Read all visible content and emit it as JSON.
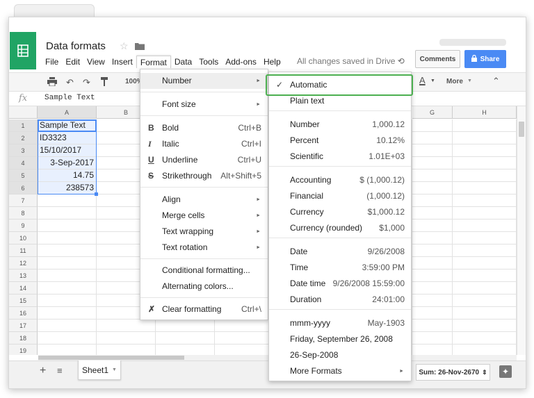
{
  "app": {
    "doc_title": "Data formats",
    "menus": [
      "File",
      "Edit",
      "View",
      "Insert",
      "Format",
      "Data",
      "Tools",
      "Add-ons",
      "Help"
    ],
    "active_menu": "Format",
    "saved_status": "All changes saved in Drive",
    "comments_label": "Comments",
    "share_label": "Share"
  },
  "toolbar": {
    "zoom": "100%",
    "more_label": "More",
    "text_color_glyph": "A"
  },
  "formula_bar": {
    "fx": "fx",
    "value": "Sample Text"
  },
  "grid": {
    "columns": [
      "A",
      "B",
      "G",
      "H"
    ],
    "rows": [
      "1",
      "2",
      "3",
      "4",
      "5",
      "6",
      "7",
      "8",
      "9",
      "10",
      "11",
      "12",
      "13",
      "14",
      "15",
      "16",
      "17",
      "18",
      "19"
    ],
    "cells": [
      {
        "text": "Sample Text",
        "align": "left"
      },
      {
        "text": "ID3323",
        "align": "left"
      },
      {
        "text": "15/10/2017",
        "align": "left"
      },
      {
        "text": "3-Sep-2017",
        "align": "right"
      },
      {
        "text": "14.75",
        "align": "right"
      },
      {
        "text": "238573",
        "align": "right"
      }
    ]
  },
  "format_menu": {
    "number": "Number",
    "font_size": "Font size",
    "bold": "Bold",
    "bold_sc": "Ctrl+B",
    "italic": "Italic",
    "italic_sc": "Ctrl+I",
    "underline": "Underline",
    "underline_sc": "Ctrl+U",
    "strike": "Strikethrough",
    "strike_sc": "Alt+Shift+5",
    "align": "Align",
    "merge": "Merge cells",
    "wrap": "Text wrapping",
    "rotate": "Text rotation",
    "conditional": "Conditional formatting...",
    "alternating": "Alternating colors...",
    "clear": "Clear formatting",
    "clear_sc": "Ctrl+\\"
  },
  "number_menu": {
    "items": [
      {
        "label": "Automatic",
        "value": ""
      },
      {
        "label": "Plain text",
        "value": ""
      },
      {
        "label": "Number",
        "value": "1,000.12"
      },
      {
        "label": "Percent",
        "value": "10.12%"
      },
      {
        "label": "Scientific",
        "value": "1.01E+03"
      },
      {
        "label": "Accounting",
        "value": "$ (1,000.12)"
      },
      {
        "label": "Financial",
        "value": "(1,000.12)"
      },
      {
        "label": "Currency",
        "value": "$1,000.12"
      },
      {
        "label": "Currency (rounded)",
        "value": "$1,000"
      },
      {
        "label": "Date",
        "value": "9/26/2008"
      },
      {
        "label": "Time",
        "value": "3:59:00 PM"
      },
      {
        "label": "Date time",
        "value": "9/26/2008 15:59:00"
      },
      {
        "label": "Duration",
        "value": "24:01:00"
      },
      {
        "label": "mmm-yyyy",
        "value": "May-1903"
      },
      {
        "label": "Friday, September 26, 2008",
        "value": ""
      },
      {
        "label": "26-Sep-2008",
        "value": ""
      },
      {
        "label": "More Formats",
        "value": ""
      }
    ],
    "checked": "Automatic"
  },
  "bottom": {
    "sheet_name": "Sheet1",
    "sum": "Sum: 26-Nov-2670"
  },
  "icons": [
    "sheets-logo-icon",
    "star-icon",
    "folder-icon",
    "history-icon",
    "lock-icon",
    "print-icon",
    "undo-icon",
    "redo-icon",
    "paint-format-icon",
    "add-sheet-icon",
    "sheet-list-icon",
    "explore-icon",
    "check-icon"
  ],
  "colors": {
    "brand": "#20a464",
    "share": "#4a8af4",
    "highlight": "#4caf50",
    "selection": "#e8f0fe"
  }
}
